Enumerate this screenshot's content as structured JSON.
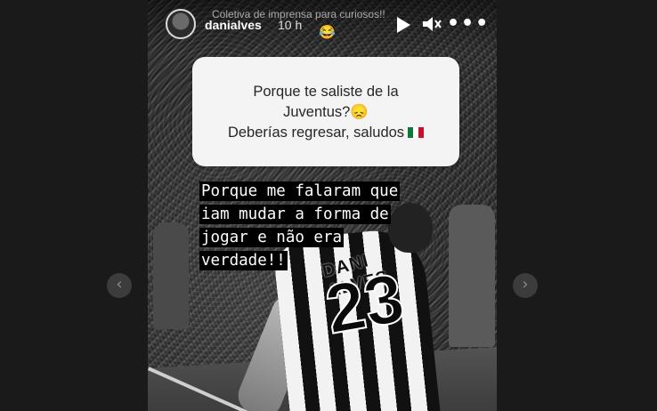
{
  "story": {
    "username": "danialves",
    "time": "10 h",
    "caption": "Coletiva de imprensa para curiosos!!",
    "caption_emoji": "😂",
    "question": {
      "line1": "Porque te saliste de la",
      "line2": "Juventus?😞",
      "line3": "Deberías regresar, saludos"
    },
    "answer": {
      "line1": "Porque me falaram que",
      "line2": "iam mudar a forma de",
      "line3": "jogar e não era",
      "line4": "verdade!!"
    },
    "shirt_name": "DANI ALVES",
    "shirt_number": "23"
  },
  "controls": {
    "prev": "‹",
    "next": "›",
    "more": "•••"
  },
  "icons": [
    "avatar",
    "play-icon",
    "mute-icon",
    "more-icon",
    "chevron-left-icon",
    "chevron-right-icon",
    "mexico-flag-icon"
  ]
}
